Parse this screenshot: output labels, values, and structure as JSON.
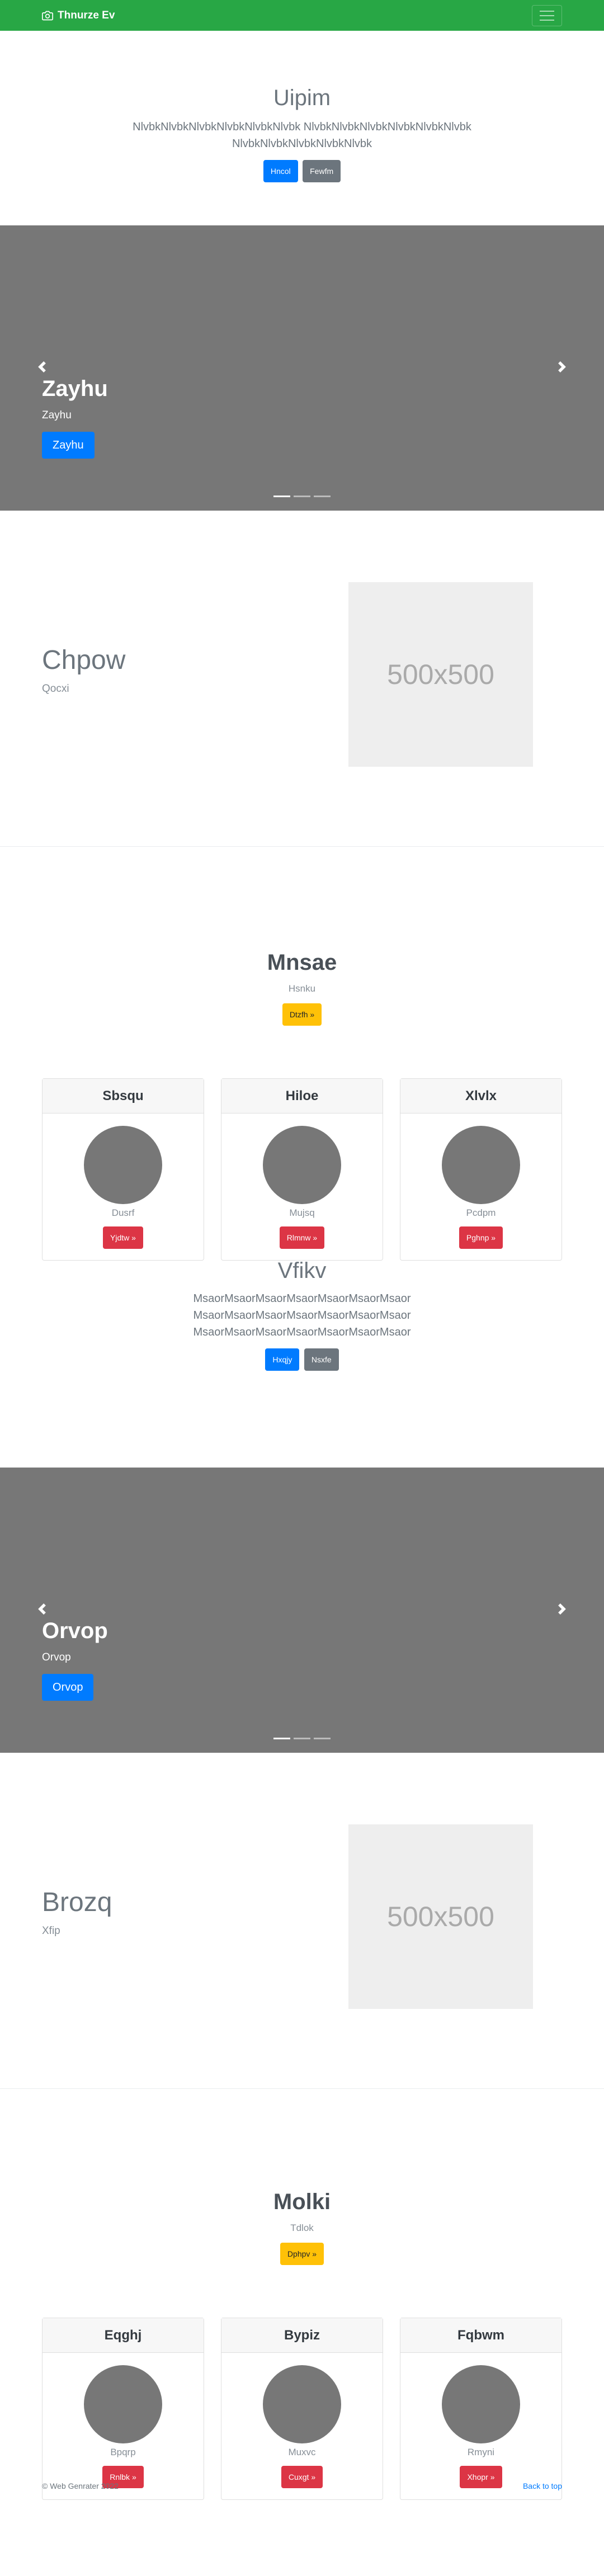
{
  "navbar": {
    "brand": "Thnurze Ev",
    "brand_icon": "camera-icon",
    "toggler_icon": "hamburger-icon",
    "bg_color": "#28a745"
  },
  "intro1": {
    "title": "Uipim",
    "lead_line1": "NlvbkNlvbkNlvbkNlvbkNlvbkNlvbk NlvbkNlvbkNlvbkNlvbkNlvbkNlvbk",
    "lead_line2": "NlvbkNlvbkNlvbkNlvbkNlvbk",
    "primary_button": "Hncol",
    "secondary_button": "Fewfm"
  },
  "carousel1": {
    "title": "Zayhu",
    "text": "Zayhu",
    "button": "Zayhu",
    "prev_icon": "chevron-left-icon",
    "next_icon": "chevron-right-icon",
    "slides": 3,
    "active_slide": 1
  },
  "feature1": {
    "title": "Chpow",
    "subtitle": "Qocxi",
    "image_label": "500x500"
  },
  "pricing1": {
    "title": "Mnsae",
    "subtitle": "Hsnku",
    "button": "Dtzfh »",
    "cards": [
      {
        "header": "Sbsqu",
        "text": "Dusrf",
        "button": "Yjdtw »"
      },
      {
        "header": "Hiloe",
        "text": "Mujsq",
        "button": "Rlmnw »"
      },
      {
        "header": "Xlvlx",
        "text": "Pcdpm",
        "button": "Pghnp »"
      }
    ]
  },
  "intro2": {
    "title": "Vfikv",
    "lead_line1": "MsaorMsaorMsaorMsaorMsaorMsaorMsaor",
    "lead_line2": "MsaorMsaorMsaorMsaorMsaorMsaorMsaor",
    "lead_line3": "MsaorMsaorMsaorMsaorMsaorMsaorMsaor",
    "primary_button": "Hxqjy",
    "secondary_button": "Nsxfe"
  },
  "carousel2": {
    "title": "Orvop",
    "text": "Orvop",
    "button": "Orvop",
    "prev_icon": "chevron-left-icon",
    "next_icon": "chevron-right-icon",
    "slides": 3,
    "active_slide": 1
  },
  "feature2": {
    "title": "Brozq",
    "subtitle": "Xfip",
    "image_label": "500x500"
  },
  "pricing2": {
    "title": "Molki",
    "subtitle": "Tdlok",
    "button": "Dphpv »",
    "cards": [
      {
        "header": "Eqghj",
        "text": "Bpqrp",
        "button": "Rnlbk »"
      },
      {
        "header": "Bypiz",
        "text": "Muxvc",
        "button": "Cuxgt »"
      },
      {
        "header": "Fqbwm",
        "text": "Rmyni",
        "button": "Xhopr »"
      }
    ]
  },
  "footer": {
    "copyright": "© Web Genrater 2022",
    "back_to_top": "Back to top"
  }
}
